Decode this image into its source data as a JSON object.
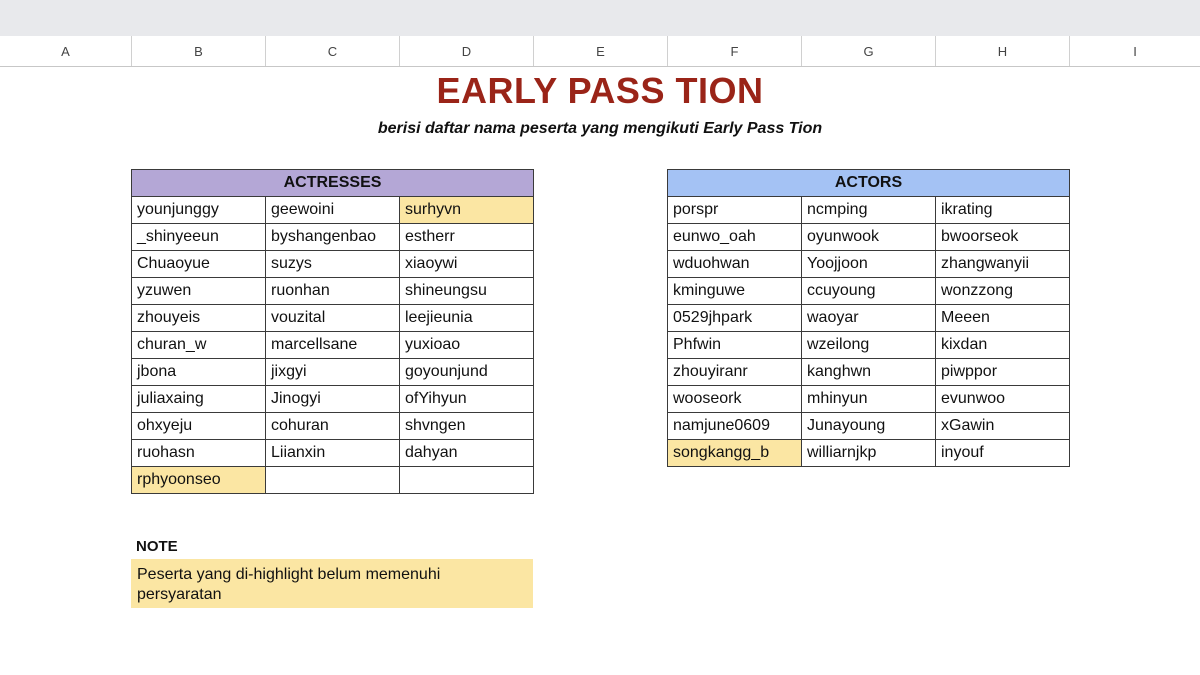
{
  "columns": [
    "A",
    "B",
    "C",
    "D",
    "E",
    "F",
    "G",
    "H",
    "I"
  ],
  "title": "EARLY PASS TION",
  "subtitle": "berisi daftar nama peserta yang mengikuti Early Pass Tion",
  "colors": {
    "title": "#9a2418",
    "actresses_header": "#b4a7d6",
    "actors_header": "#a4c2f4",
    "highlight": "#fbe6a3"
  },
  "actresses": {
    "header": "ACTRESSES",
    "rows": [
      [
        {
          "text": "younjunggy"
        },
        {
          "text": "geewoini"
        },
        {
          "text": "surhyvn",
          "hl": true
        }
      ],
      [
        {
          "text": "_shinyeeun"
        },
        {
          "text": "byshangenbao"
        },
        {
          "text": "estherr"
        }
      ],
      [
        {
          "text": "Chuaoyue"
        },
        {
          "text": "suzys"
        },
        {
          "text": "xiaoywi"
        }
      ],
      [
        {
          "text": "yzuwen"
        },
        {
          "text": "ruonhan"
        },
        {
          "text": "shineungsu"
        }
      ],
      [
        {
          "text": "zhouyeis"
        },
        {
          "text": "vouzital"
        },
        {
          "text": "leejieunia"
        }
      ],
      [
        {
          "text": "churan_w"
        },
        {
          "text": "marcellsane"
        },
        {
          "text": "yuxioao"
        }
      ],
      [
        {
          "text": "jbona"
        },
        {
          "text": "jixgyi"
        },
        {
          "text": "goyounjund"
        }
      ],
      [
        {
          "text": "juliaxaing"
        },
        {
          "text": "Jinogyi"
        },
        {
          "text": "ofYihyun"
        }
      ],
      [
        {
          "text": "ohxyeju"
        },
        {
          "text": "cohuran"
        },
        {
          "text": "shvngen"
        }
      ],
      [
        {
          "text": "ruohasn"
        },
        {
          "text": "Liianxin"
        },
        {
          "text": "dahyan"
        }
      ],
      [
        {
          "text": "rphyoonseo",
          "hl": true
        },
        {
          "text": ""
        },
        {
          "text": ""
        }
      ]
    ]
  },
  "actors": {
    "header": "ACTORS",
    "rows": [
      [
        {
          "text": "porspr"
        },
        {
          "text": "ncmping"
        },
        {
          "text": "ikrating"
        }
      ],
      [
        {
          "text": "eunwo_oah"
        },
        {
          "text": "oyunwook"
        },
        {
          "text": "bwoorseok"
        }
      ],
      [
        {
          "text": "wduohwan"
        },
        {
          "text": "Yoojjoon"
        },
        {
          "text": "zhangwanyii"
        }
      ],
      [
        {
          "text": "kminguwe"
        },
        {
          "text": "ccuyoung"
        },
        {
          "text": "wonzzong"
        }
      ],
      [
        {
          "text": "0529jhpark"
        },
        {
          "text": "waoyar"
        },
        {
          "text": "Meeen"
        }
      ],
      [
        {
          "text": "Phfwin"
        },
        {
          "text": "wzeilong"
        },
        {
          "text": "kixdan"
        }
      ],
      [
        {
          "text": "zhouyiranr"
        },
        {
          "text": "kanghwn"
        },
        {
          "text": "piwppor"
        }
      ],
      [
        {
          "text": "wooseork"
        },
        {
          "text": "mhinyun"
        },
        {
          "text": "evunwoo"
        }
      ],
      [
        {
          "text": "namjune0609"
        },
        {
          "text": "Junayoung"
        },
        {
          "text": "xGawin"
        }
      ],
      [
        {
          "text": "songkangg_b",
          "hl": true
        },
        {
          "text": "williarnjkp"
        },
        {
          "text": "inyouf"
        }
      ]
    ]
  },
  "note": {
    "label": "NOTE",
    "text": "Peserta yang di-highlight belum memenuhi persyaratan"
  }
}
